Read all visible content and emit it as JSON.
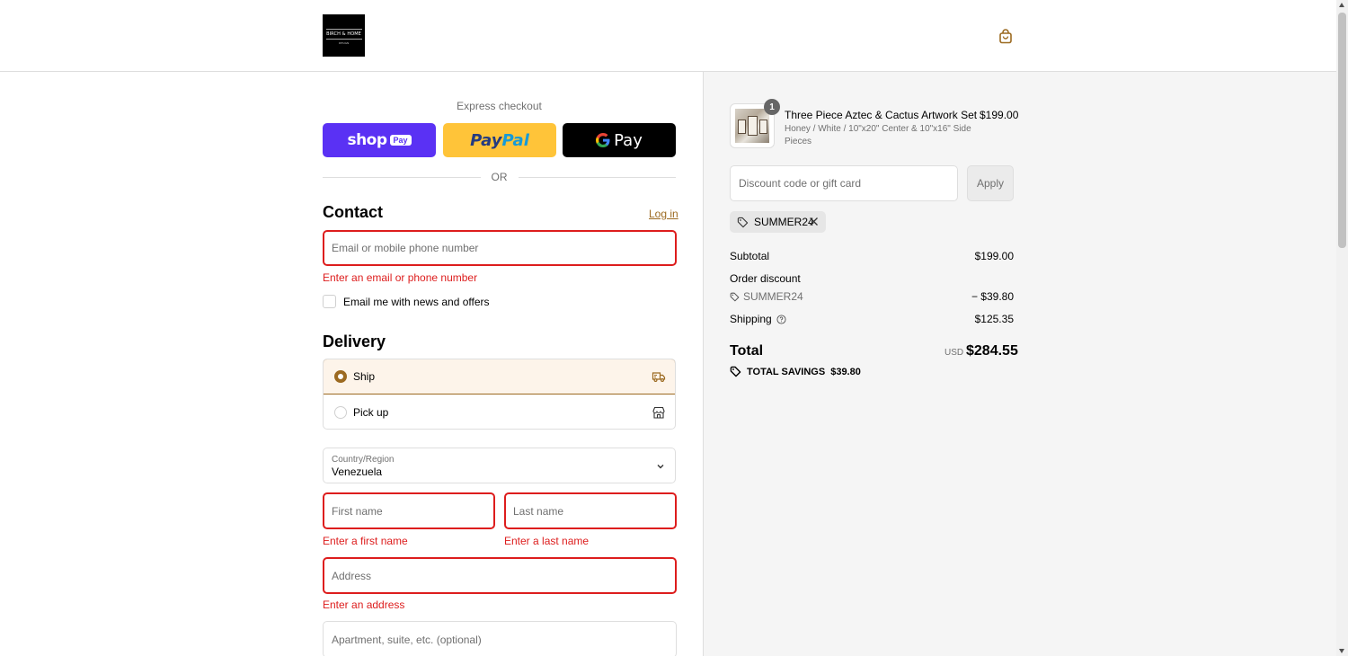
{
  "header": {
    "logo_text": "BIRCH & HOME",
    "logo_sub": "DESIGN"
  },
  "express": {
    "label": "Express checkout",
    "shop_pay": "shop",
    "shop_pay_tag": "Pay",
    "paypal_a": "Pay",
    "paypal_b": "Pal",
    "gpay_g": "G",
    "gpay_pay": "Pay",
    "or": "OR"
  },
  "contact": {
    "title": "Contact",
    "login": "Log in",
    "email_placeholder": "Email or mobile phone number",
    "email_error": "Enter an email or phone number",
    "newsletter": "Email me with news and offers"
  },
  "delivery": {
    "title": "Delivery",
    "option_ship": "Ship",
    "option_pickup": "Pick up",
    "country_label": "Country/Region",
    "country_value": "Venezuela",
    "first_name_placeholder": "First name",
    "first_name_error": "Enter a first name",
    "last_name_placeholder": "Last name",
    "last_name_error": "Enter a last name",
    "address_placeholder": "Address",
    "address_error": "Enter an address",
    "apartment_placeholder": "Apartment, suite, etc. (optional)"
  },
  "summary": {
    "item": {
      "qty": "1",
      "title": "Three Piece Aztec & Cactus Artwork Set",
      "variant": "Honey / White / 10\"x20\" Center & 10\"x16\" Side Pieces",
      "price": "$199.00"
    },
    "discount_placeholder": "Discount code or gift card",
    "apply": "Apply",
    "applied_code": "SUMMER24",
    "subtotal_label": "Subtotal",
    "subtotal_value": "$199.00",
    "order_discount_label": "Order discount",
    "discount_code": "SUMMER24",
    "discount_value": "− $39.80",
    "shipping_label": "Shipping",
    "shipping_value": "$125.35",
    "total_label": "Total",
    "currency": "USD",
    "total_value": "$284.55",
    "savings_label": "TOTAL SAVINGS",
    "savings_value": "$39.80"
  },
  "colors": {
    "accent": "#9c6a21",
    "error": "#dd1d1d",
    "shop_pay": "#5a31f4",
    "paypal": "#ffc439"
  }
}
